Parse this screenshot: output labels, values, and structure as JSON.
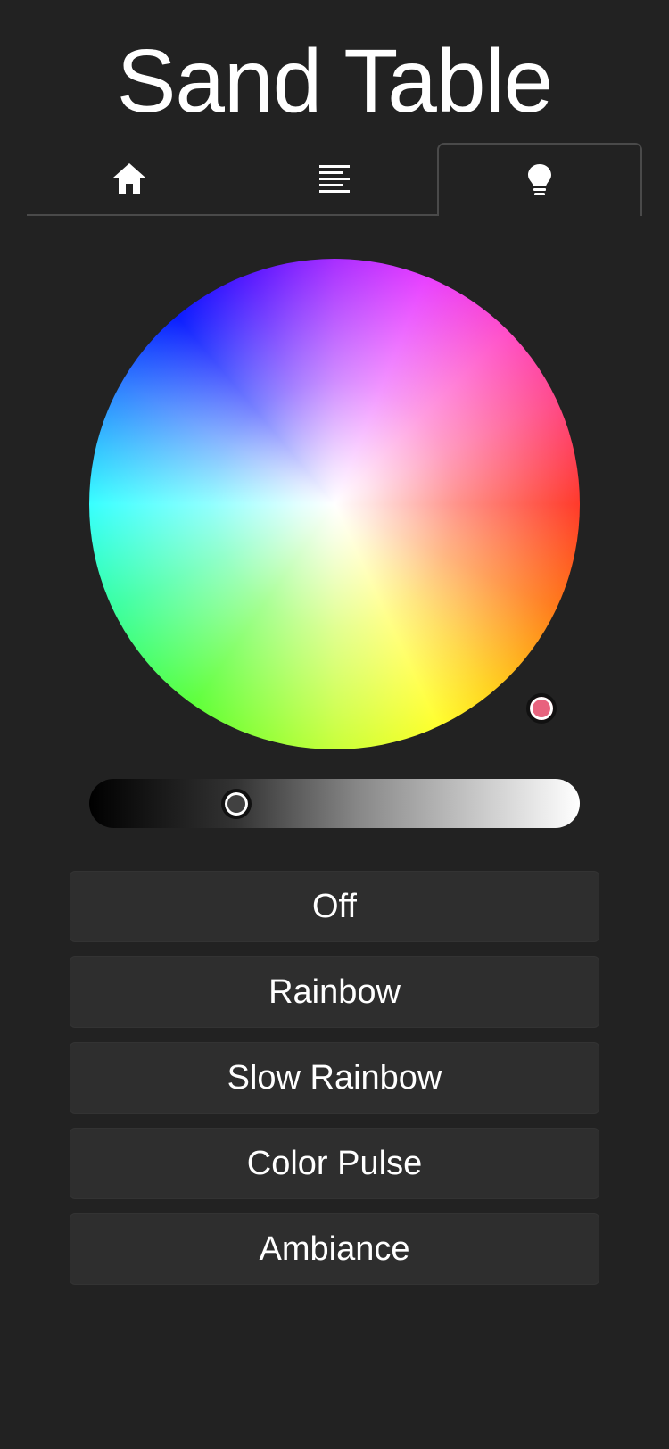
{
  "app": {
    "title": "Sand Table"
  },
  "tabs": [
    {
      "id": "home",
      "icon": "home-icon",
      "active": false
    },
    {
      "id": "list",
      "icon": "align-left-icon",
      "active": false
    },
    {
      "id": "light",
      "icon": "lightbulb-icon",
      "active": true
    }
  ],
  "color_picker": {
    "selected_color": "#e8637e",
    "brightness": 0.3
  },
  "modes": [
    {
      "label": "Off"
    },
    {
      "label": "Rainbow"
    },
    {
      "label": "Slow Rainbow"
    },
    {
      "label": "Color Pulse"
    },
    {
      "label": "Ambiance"
    }
  ],
  "colors": {
    "background": "#222222",
    "button_bg": "#2e2e2e",
    "border": "#4a4a4a",
    "text": "#ffffff"
  }
}
